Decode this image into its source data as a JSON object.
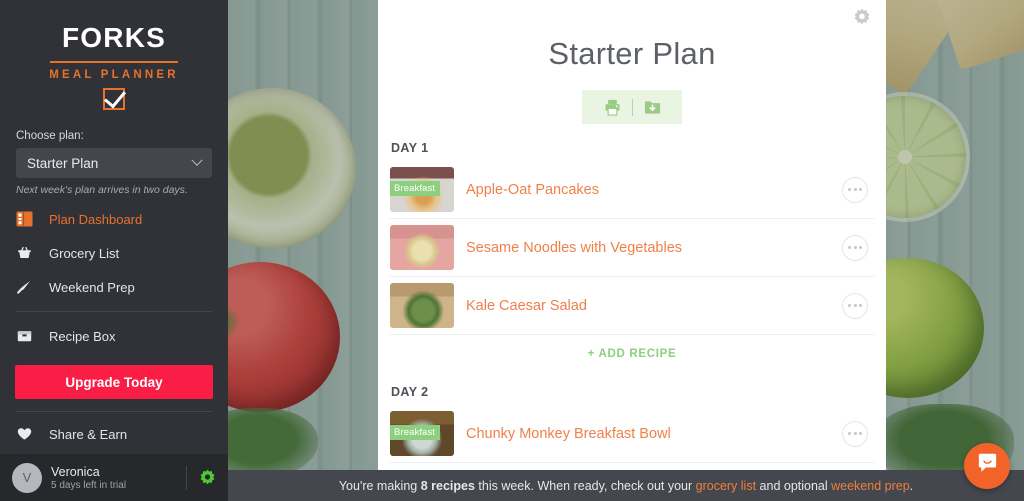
{
  "sidebar": {
    "brand": {
      "title": "FORKS",
      "subtitle": "MEAL PLANNER",
      "check_icon": "checkbox-checked-icon"
    },
    "plan_chooser": {
      "label": "Choose plan:",
      "selected": "Starter Plan",
      "note": "Next week's plan arrives in two days.",
      "chevron_icon": "chevron-down-icon"
    },
    "nav_items": [
      {
        "label": "Plan Dashboard",
        "icon": "dashboard-icon",
        "active": true
      },
      {
        "label": "Grocery List",
        "icon": "basket-icon",
        "active": false
      },
      {
        "label": "Weekend Prep",
        "icon": "knife-icon",
        "active": false
      },
      {
        "label": "Recipe Box",
        "icon": "recipe-box-icon",
        "active": false
      }
    ],
    "upgrade_label": "Upgrade Today",
    "share": {
      "label": "Share & Earn",
      "icon": "heart-icon"
    },
    "user": {
      "initial": "V",
      "name": "Veronica",
      "subtitle": "5 days left in trial",
      "settings_icon": "gear-icon"
    }
  },
  "main": {
    "title": "Starter Plan",
    "settings_icon": "gear-icon",
    "actions": [
      {
        "icon": "print-icon",
        "name": "print-plan-button"
      },
      {
        "icon": "folder-download-icon",
        "name": "save-plan-button"
      }
    ],
    "add_recipe_label": "+ ADD RECIPE",
    "days": [
      {
        "label": "DAY 1",
        "recipes": [
          {
            "name": "Apple-Oat Pancakes",
            "badge": "Breakfast",
            "thumb": "thumb-pancakes"
          },
          {
            "name": "Sesame Noodles with Vegetables",
            "badge": "",
            "thumb": "thumb-noodles"
          },
          {
            "name": "Kale Caesar Salad",
            "badge": "",
            "thumb": "thumb-salad"
          }
        ]
      },
      {
        "label": "DAY 2",
        "recipes": [
          {
            "name": "Chunky Monkey Breakfast Bowl",
            "badge": "Breakfast",
            "thumb": "thumb-bowl"
          }
        ]
      }
    ]
  },
  "statusbar": {
    "prefix": "You're making ",
    "count": "8 recipes",
    "middle": " this week. When ready, check out your ",
    "link1": "grocery list",
    "conjunction": " and optional ",
    "link2": "weekend prep",
    "suffix": "."
  },
  "chat": {
    "icon": "chat-smile-icon"
  },
  "colors": {
    "brand_orange": "#e8722b",
    "recipe_orange": "#f0804a",
    "accent_green": "#8ccf7e",
    "upgrade_red": "#fa1e46",
    "sidebar_bg": "#303238",
    "statusbar_bg": "#44474d",
    "chat_orange": "#f2632a"
  }
}
